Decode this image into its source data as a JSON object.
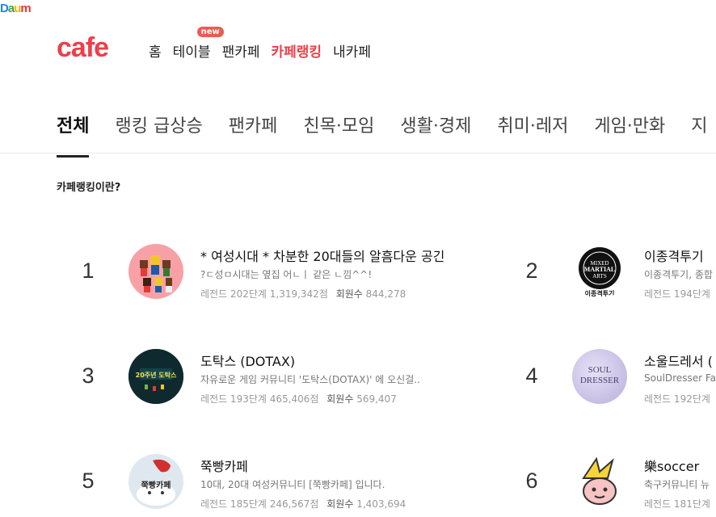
{
  "daum_logo": {
    "letters": [
      "D",
      "a",
      "u",
      "m"
    ],
    "colors": [
      "#1e88e5",
      "#43a047",
      "#f4b400",
      "#e53935"
    ]
  },
  "cafe_logo": "cafe",
  "gnb": {
    "items": [
      {
        "label": "홈"
      },
      {
        "label": "테이블",
        "badge": "new"
      },
      {
        "label": "팬카페"
      },
      {
        "label": "카페랭킹",
        "active": true
      },
      {
        "label": "내카페"
      }
    ]
  },
  "category_tabs": [
    {
      "label": "전체",
      "active": true
    },
    {
      "label": "랭킹 급상승"
    },
    {
      "label": "팬카페"
    },
    {
      "label": "친목·모임"
    },
    {
      "label": "생활·경제"
    },
    {
      "label": "취미·레저"
    },
    {
      "label": "게임·만화"
    },
    {
      "label": "지"
    }
  ],
  "info_link": "카페랭킹이란?",
  "meta_labels": {
    "members": "회원수"
  },
  "ranking": [
    {
      "rank": "1",
      "name": "* 여성시대 *  차분한 20대들의 알흠다운 공긴",
      "desc": "?ㄷ성ㅁ시대는 옆집 어ㄴㅣ 같은 ㄴ낌^^!",
      "level": "레전드 202단계",
      "score": "1,319,342점",
      "members": "844,278",
      "thumb_bg": "#f7a1a7",
      "thumb_icon": "pixel-characters-icon"
    },
    {
      "rank": "2",
      "name": "이종격투기",
      "desc": "이종격투기, 종합",
      "level": "레전드 194단계",
      "score": "",
      "members": "",
      "thumb_bg": "#ffffff",
      "thumb_icon": "mma-emblem-icon",
      "thumb_caption": "이종격투기"
    },
    {
      "rank": "3",
      "name": "도탁스 (DOTAX)",
      "desc": "자유로운 게임 커뮤니티 '도탁스(DOTAX)' 에 오신걸..",
      "level": "레전드 193단계",
      "score": "465,406점",
      "members": "569,407",
      "thumb_bg": "#0f2a2e",
      "thumb_icon": "dotax-banner-icon",
      "thumb_caption": "20주년 도탁스"
    },
    {
      "rank": "4",
      "name": "소울드레서 (",
      "desc": "SoulDresser Fa",
      "level": "레전드 192단계",
      "score": "",
      "members": "",
      "thumb_bg": "#c9c3e6",
      "thumb_icon": "soul-dresser-logo-icon",
      "thumb_caption": "SOUL DRESSER"
    },
    {
      "rank": "5",
      "name": "쭉빵카페",
      "desc": "10대, 20대 여성커뮤니티 [쭉빵카페] 입니다.",
      "level": "레전드 185단계",
      "score": "246,567점",
      "members": "1,403,694",
      "thumb_bg": "#dfe8ee",
      "thumb_icon": "jjukbbang-icon",
      "thumb_caption": "쭉빵카페"
    },
    {
      "rank": "6",
      "name": "樂soccer",
      "desc": "축구커뮤니티 뉴",
      "level": "레전드 181단계",
      "score": "",
      "members": "",
      "thumb_bg": "#ffffff",
      "thumb_icon": "soccer-mascot-icon"
    }
  ]
}
